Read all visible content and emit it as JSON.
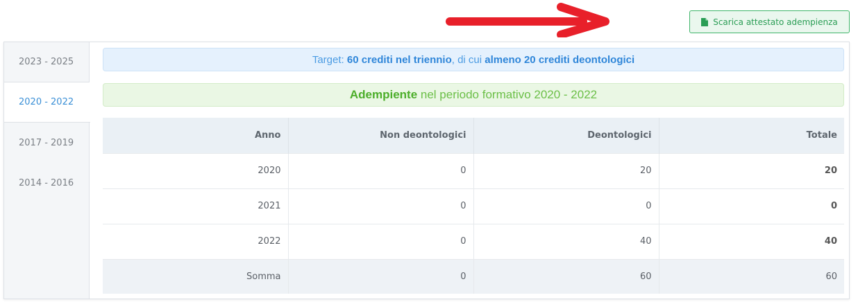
{
  "download_button": {
    "label": "Scarica attestato adempienza",
    "icon": "document-icon"
  },
  "tabs": [
    "2023 - 2025",
    "2020 - 2022",
    "2017 - 2019",
    "2014 - 2016"
  ],
  "active_tab": "2020 - 2022",
  "target_banner": {
    "prefix": "Target: ",
    "credits": "60 crediti nel triennio",
    "middle": ", di cui ",
    "deontological": "almeno 20 crediti deontologici"
  },
  "status_banner": {
    "status": "Adempiente",
    "text": " nel periodo formativo 2020 - 2022"
  },
  "table": {
    "headers": [
      "Anno",
      "Non deontologici",
      "Deontologici",
      "Totale"
    ],
    "rows": [
      [
        "2020",
        "0",
        "20",
        "20"
      ],
      [
        "2021",
        "0",
        "0",
        "0"
      ],
      [
        "2022",
        "0",
        "40",
        "40"
      ]
    ],
    "sum": [
      "Somma",
      "0",
      "60",
      "60"
    ]
  },
  "colors": {
    "accent_blue": "#3a8fd6",
    "success_green": "#4cae2a",
    "arrow_red": "#e8202a"
  }
}
